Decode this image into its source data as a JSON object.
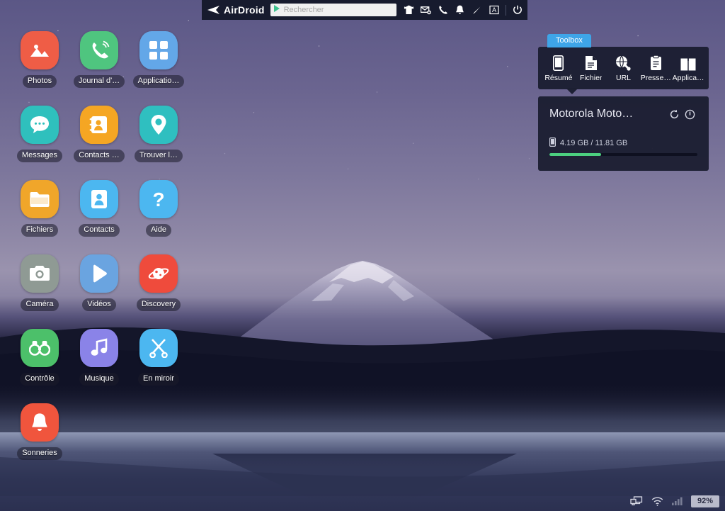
{
  "topbar": {
    "brand": "AirDroid",
    "search": {
      "placeholder": "Rechercher",
      "value": "",
      "play_icon": "google-play-icon"
    },
    "icons": [
      {
        "name": "upload-icon",
        "glyph": "upload"
      },
      {
        "name": "mail-icon",
        "glyph": "mail"
      },
      {
        "name": "phone-icon",
        "glyph": "phone"
      },
      {
        "name": "notification-icon",
        "glyph": "bell"
      },
      {
        "name": "edit-icon",
        "glyph": "pen"
      },
      {
        "name": "text-icon",
        "glyph": "a-box"
      },
      {
        "name": "power-icon",
        "glyph": "power"
      }
    ]
  },
  "apps": [
    {
      "label": "Photos",
      "icon": "photos-icon",
      "color": "#ef5d46"
    },
    {
      "label": "Journal d'…",
      "icon": "call-log-icon",
      "color": "#4fc57f"
    },
    {
      "label": "Applicatio…",
      "icon": "apps-icon",
      "color": "#63a7e8"
    },
    {
      "label": "Messages",
      "icon": "messages-icon",
      "color": "#2fc0bd"
    },
    {
      "label": "Contacts …",
      "icon": "contacts-card-icon",
      "color": "#f5a623"
    },
    {
      "label": "Trouver l…",
      "icon": "find-phone-icon",
      "color": "#2fbfc0"
    },
    {
      "label": "Fichiers",
      "icon": "files-icon",
      "color": "#f0a62a"
    },
    {
      "label": "Contacts",
      "icon": "contacts-icon",
      "color": "#4cb7f0"
    },
    {
      "label": "Aide",
      "icon": "help-icon",
      "color": "#4cb7f0"
    },
    {
      "label": "Caméra",
      "icon": "camera-icon",
      "color": "#8f9a94"
    },
    {
      "label": "Vidéos",
      "icon": "videos-icon",
      "color": "#6aa4e0"
    },
    {
      "label": "Discovery",
      "icon": "discovery-icon",
      "color": "#ef4b3c"
    },
    {
      "label": "Contrôle",
      "icon": "control-icon",
      "color": "#4cc06a"
    },
    {
      "label": "Musique",
      "icon": "music-icon",
      "color": "#8a83e8"
    },
    {
      "label": "En miroir",
      "icon": "mirror-icon",
      "color": "#4cb7f0"
    },
    {
      "label": "Sonneries",
      "icon": "ringtones-icon",
      "color": "#f0553d"
    }
  ],
  "toolbox": {
    "tab_label": "Toolbox",
    "items": [
      {
        "label": "Résumé",
        "icon": "phone-summary-icon"
      },
      {
        "label": "Fichier",
        "icon": "document-icon"
      },
      {
        "label": "URL",
        "icon": "globe-link-icon"
      },
      {
        "label": "Presse…",
        "icon": "clipboard-icon"
      },
      {
        "label": "Applica…",
        "icon": "package-icon"
      }
    ]
  },
  "device": {
    "name": "Motorola Moto…",
    "refresh_icon": "refresh-icon",
    "info_icon": "info-icon",
    "storage_icon": "phone-storage-icon",
    "storage_text": "4.19 GB / 11.81 GB",
    "storage_used_percent": 35,
    "fill_color": "#4cd080"
  },
  "statusbar": {
    "icons": [
      {
        "name": "screens-icon",
        "glyph": "screens"
      },
      {
        "name": "wifi-icon",
        "glyph": "wifi"
      },
      {
        "name": "signal-icon",
        "glyph": "signal"
      }
    ],
    "battery": "92%"
  }
}
